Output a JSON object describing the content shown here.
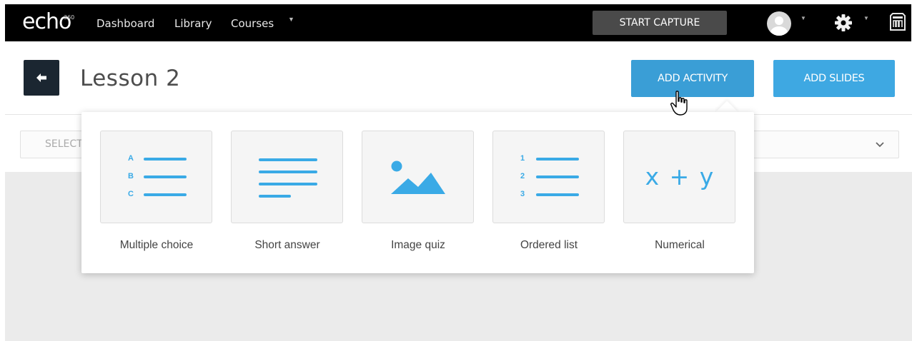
{
  "nav": {
    "logo": "echo",
    "logo_sup": "360",
    "links": [
      "Dashboard",
      "Library",
      "Courses"
    ],
    "courses_caret": "▼",
    "start_capture": "START CAPTURE",
    "avatar_caret": "▼",
    "settings_caret": "▼"
  },
  "header": {
    "title": "Lesson 2",
    "add_activity": "ADD ACTIVITY",
    "add_slides": "ADD SLIDES"
  },
  "select": {
    "placeholder": "SELECT"
  },
  "activities": [
    {
      "label": "Multiple choice",
      "icon": "multiple-choice-icon",
      "letters": [
        "A",
        "B",
        "C"
      ]
    },
    {
      "label": "Short answer",
      "icon": "short-answer-icon"
    },
    {
      "label": "Image quiz",
      "icon": "image-quiz-icon"
    },
    {
      "label": "Ordered list",
      "icon": "ordered-list-icon",
      "numbers": [
        "1",
        "2",
        "3"
      ]
    },
    {
      "label": "Numerical",
      "icon": "numerical-icon",
      "symbol": "x + y"
    }
  ],
  "colors": {
    "accent": "#3a9ed6",
    "icon_blue": "#3aaae6",
    "nav_bg": "#000000",
    "back_btn": "#1b2631"
  }
}
